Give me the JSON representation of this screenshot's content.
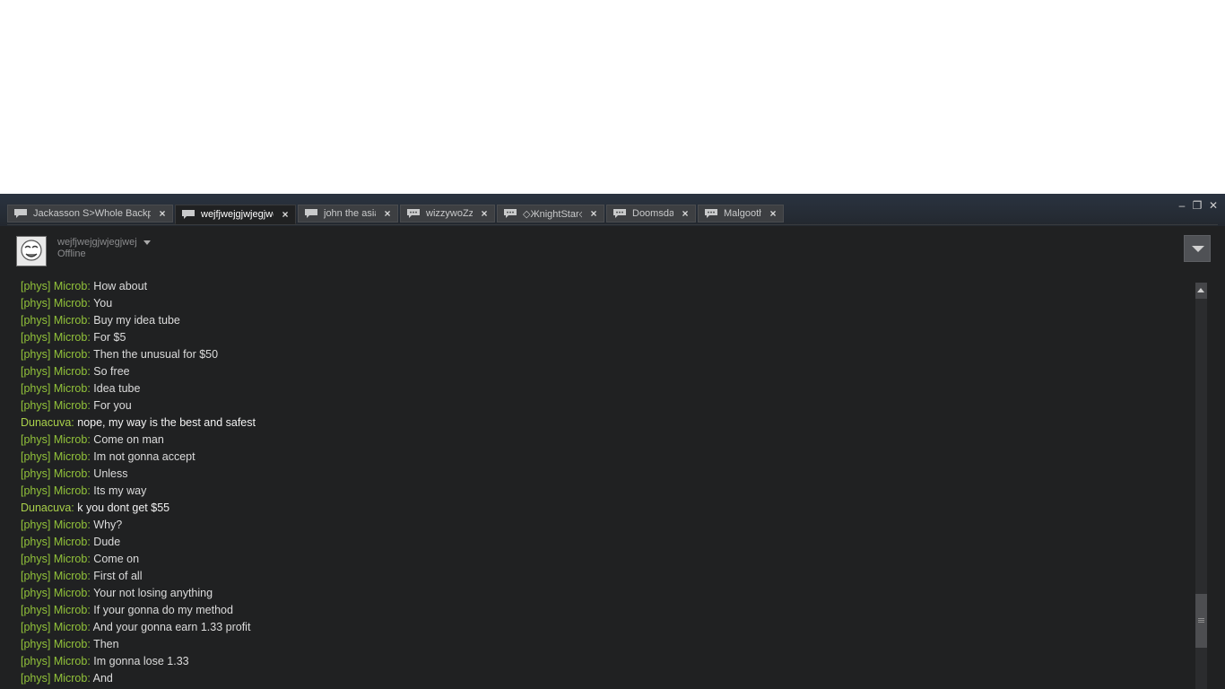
{
  "tabs": [
    {
      "label": "Jackasson S>Whole Backp...",
      "active": false,
      "icon": "chat-bubble-icon"
    },
    {
      "label": "wejfjwejgjwjegjwej",
      "active": true,
      "icon": "chat-bubble-icon"
    },
    {
      "label": "john the asian",
      "active": false,
      "icon": "chat-bubble-icon"
    },
    {
      "label": "wizzywoZzy",
      "active": false,
      "icon": "chat-bubble-dots-icon"
    },
    {
      "label": "◇ЖnightStar◇",
      "active": false,
      "icon": "chat-bubble-dots-icon"
    },
    {
      "label": "Doomsday",
      "active": false,
      "icon": "chat-bubble-dots-icon"
    },
    {
      "label": "Malgooth",
      "active": false,
      "icon": "chat-bubble-dots-icon"
    }
  ],
  "window_controls": {
    "minimize": "–",
    "restore": "❐",
    "close": "✕"
  },
  "friend": {
    "name": "wejfjwejgjwjegjwej",
    "status": "Offline"
  },
  "messages": [
    {
      "from": "[phys] Microb",
      "text": "How about"
    },
    {
      "from": "[phys] Microb",
      "text": "You"
    },
    {
      "from": "[phys] Microb",
      "text": "Buy my idea tube"
    },
    {
      "from": "[phys] Microb",
      "text": "For $5"
    },
    {
      "from": "[phys] Microb",
      "text": "Then the unusual for $50"
    },
    {
      "from": "[phys] Microb",
      "text": "So free"
    },
    {
      "from": "[phys] Microb",
      "text": "Idea tube"
    },
    {
      "from": "[phys] Microb",
      "text": "For you"
    },
    {
      "from": "Dunacuva",
      "text": "nope, my way is the best and safest"
    },
    {
      "from": "[phys] Microb",
      "text": "Come on man"
    },
    {
      "from": "[phys] Microb",
      "text": "Im not gonna accept"
    },
    {
      "from": "[phys] Microb",
      "text": "Unless"
    },
    {
      "from": "[phys] Microb",
      "text": "Its my way"
    },
    {
      "from": "Dunacuva",
      "text": "k you dont get $55"
    },
    {
      "from": "[phys] Microb",
      "text": "Why?"
    },
    {
      "from": "[phys] Microb",
      "text": "Dude"
    },
    {
      "from": "[phys] Microb",
      "text": "Come on"
    },
    {
      "from": "[phys] Microb",
      "text": "First of all"
    },
    {
      "from": "[phys] Microb",
      "text": "Your not losing anything"
    },
    {
      "from": "[phys] Microb",
      "text": "If your gonna do my method"
    },
    {
      "from": "[phys] Microb",
      "text": "And your gonna earn 1.33 profit"
    },
    {
      "from": "[phys] Microb",
      "text": "Then"
    },
    {
      "from": "[phys] Microb",
      "text": "Im gonna lose 1.33"
    },
    {
      "from": "[phys] Microb",
      "text": "And"
    }
  ],
  "separator": ": "
}
